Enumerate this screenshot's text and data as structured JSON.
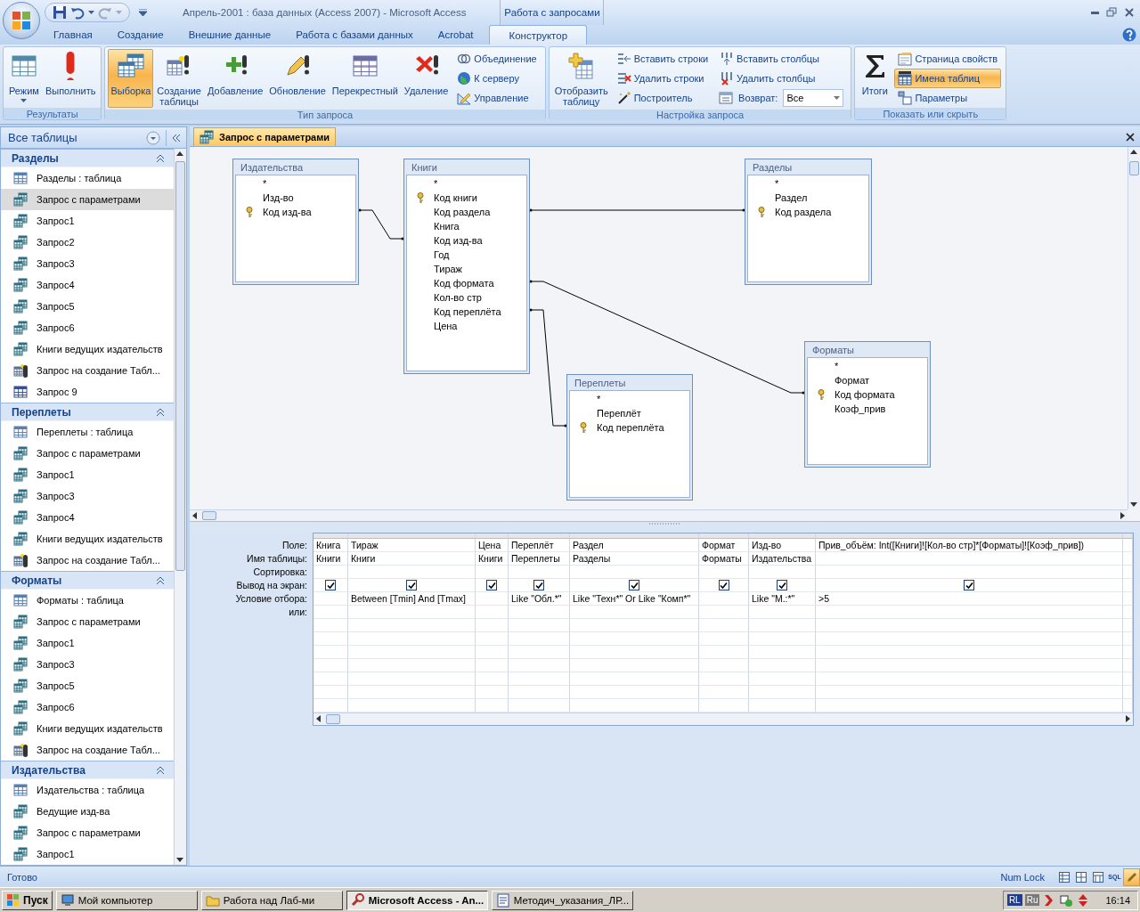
{
  "window": {
    "title": "Апрель-2001 : база данных (Access 2007)  -  Microsoft Access",
    "context_tab": "Работа с запросами"
  },
  "ribbon_tabs": [
    {
      "label": "Главная",
      "selected": false
    },
    {
      "label": "Создание",
      "selected": false
    },
    {
      "label": "Внешние данные",
      "selected": false
    },
    {
      "label": "Работа с базами данных",
      "selected": false
    },
    {
      "label": "Acrobat",
      "selected": false
    },
    {
      "label": "Конструктор",
      "selected": true
    }
  ],
  "ribbon_groups": [
    {
      "title": "Результаты",
      "large": [
        {
          "label": "Режим",
          "dropdown": true,
          "selected": false
        },
        {
          "label": "Выполнить",
          "dropdown": false,
          "selected": false
        }
      ]
    },
    {
      "title": "Тип запроса",
      "large": [
        {
          "label": "Выборка",
          "dropdown": false,
          "selected": true
        },
        {
          "label": "Создание\nтаблицы",
          "dropdown": false,
          "selected": false
        },
        {
          "label": "Добавление",
          "dropdown": false,
          "selected": false
        },
        {
          "label": "Обновление",
          "dropdown": false,
          "selected": false
        },
        {
          "label": "Перекрестный",
          "dropdown": false,
          "selected": false
        },
        {
          "label": "Удаление",
          "dropdown": false,
          "selected": false
        }
      ],
      "small_columns": [
        [
          {
            "label": "Объединение",
            "kind": "button",
            "selected": false
          },
          {
            "label": "К серверу",
            "kind": "button",
            "selected": false
          },
          {
            "label": "Управление",
            "kind": "button",
            "selected": false
          }
        ]
      ]
    },
    {
      "title": "Настройка запроса",
      "large": [
        {
          "label": "Отобразить\nтаблицу",
          "dropdown": false,
          "selected": false
        }
      ],
      "small_columns": [
        [
          {
            "label": "Вставить строки",
            "kind": "button",
            "selected": false
          },
          {
            "label": "Удалить строки",
            "kind": "button",
            "selected": false
          },
          {
            "label": "Построитель",
            "kind": "button",
            "selected": false
          }
        ],
        [
          {
            "label": "Вставить столбцы",
            "kind": "button",
            "selected": false
          },
          {
            "label": "Удалить столбцы",
            "kind": "button",
            "selected": false
          },
          {
            "label": "Возврат:",
            "kind": "combo",
            "value": "Все"
          }
        ]
      ]
    },
    {
      "title": "Показать или скрыть",
      "large": [
        {
          "label": "Итоги",
          "dropdown": false,
          "selected": false
        }
      ],
      "small_columns": [
        [
          {
            "label": "Страница свойств",
            "kind": "button",
            "selected": false
          },
          {
            "label": "Имена таблиц",
            "kind": "button",
            "selected": true
          },
          {
            "label": "Параметры",
            "kind": "button",
            "selected": false
          }
        ]
      ]
    }
  ],
  "navigation": {
    "title": "Все таблицы",
    "groups": [
      {
        "title": "Разделы",
        "expanded": true,
        "items": [
          {
            "label": "Разделы : таблица",
            "kind": "table",
            "selected": false
          },
          {
            "label": "Запрос с параметрами",
            "kind": "query",
            "selected": true
          },
          {
            "label": "Запрос1",
            "kind": "query",
            "selected": false
          },
          {
            "label": "Запрос2",
            "kind": "query",
            "selected": false
          },
          {
            "label": "Запрос3",
            "kind": "query",
            "selected": false
          },
          {
            "label": "Запрос4",
            "kind": "query",
            "selected": false
          },
          {
            "label": "Запрос5",
            "kind": "query",
            "selected": false
          },
          {
            "label": "Запрос6",
            "kind": "query",
            "selected": false
          },
          {
            "label": "Книги ведущих издательств",
            "kind": "query",
            "selected": false
          },
          {
            "label": "Запрос на создание Табл...",
            "kind": "make_table",
            "selected": false
          },
          {
            "label": "Запрос 9",
            "kind": "crosstab",
            "selected": false
          }
        ]
      },
      {
        "title": "Переплеты",
        "expanded": true,
        "items": [
          {
            "label": "Переплеты : таблица",
            "kind": "table",
            "selected": false
          },
          {
            "label": "Запрос с параметрами",
            "kind": "query",
            "selected": false
          },
          {
            "label": "Запрос1",
            "kind": "query",
            "selected": false
          },
          {
            "label": "Запрос3",
            "kind": "query",
            "selected": false
          },
          {
            "label": "Запрос4",
            "kind": "query",
            "selected": false
          },
          {
            "label": "Книги ведущих издательств",
            "kind": "query",
            "selected": false
          },
          {
            "label": "Запрос на создание Табл...",
            "kind": "make_table",
            "selected": false
          }
        ]
      },
      {
        "title": "Форматы",
        "expanded": true,
        "items": [
          {
            "label": "Форматы : таблица",
            "kind": "table",
            "selected": false
          },
          {
            "label": "Запрос с параметрами",
            "kind": "query",
            "selected": false
          },
          {
            "label": "Запрос1",
            "kind": "query",
            "selected": false
          },
          {
            "label": "Запрос3",
            "kind": "query",
            "selected": false
          },
          {
            "label": "Запрос5",
            "kind": "query",
            "selected": false
          },
          {
            "label": "Запрос6",
            "kind": "query",
            "selected": false
          },
          {
            "label": "Книги ведущих издательств",
            "kind": "query",
            "selected": false
          },
          {
            "label": "Запрос на создание Табл...",
            "kind": "make_table",
            "selected": false
          }
        ]
      },
      {
        "title": "Издательства",
        "expanded": true,
        "items": [
          {
            "label": "Издательства : таблица",
            "kind": "table",
            "selected": false
          },
          {
            "label": "Ведущие изд-ва",
            "kind": "query",
            "selected": false
          },
          {
            "label": "Запрос с параметрами",
            "kind": "query",
            "selected": false
          },
          {
            "label": "Запрос1",
            "kind": "query",
            "selected": false
          }
        ]
      }
    ]
  },
  "document_tab": {
    "title": "Запрос с параметрами"
  },
  "diagram": {
    "tables": [
      {
        "title": "Издательства",
        "fields": [
          {
            "name": "*",
            "key": false
          },
          {
            "name": "Изд-во",
            "key": false
          },
          {
            "name": "Код изд-ва",
            "key": true
          }
        ]
      },
      {
        "title": "Книги",
        "fields": [
          {
            "name": "*",
            "key": false
          },
          {
            "name": "Код книги",
            "key": true
          },
          {
            "name": "Код раздела",
            "key": false
          },
          {
            "name": "Книга",
            "key": false
          },
          {
            "name": "Код изд-ва",
            "key": false
          },
          {
            "name": "Год",
            "key": false
          },
          {
            "name": "Тираж",
            "key": false
          },
          {
            "name": "Код формата",
            "key": false
          },
          {
            "name": "Кол-во стр",
            "key": false
          },
          {
            "name": "Код переплёта",
            "key": false
          },
          {
            "name": "Цена",
            "key": false
          }
        ]
      },
      {
        "title": "Разделы",
        "fields": [
          {
            "name": "*",
            "key": false
          },
          {
            "name": "Раздел",
            "key": false
          },
          {
            "name": "Код раздела",
            "key": true
          }
        ]
      },
      {
        "title": "Форматы",
        "fields": [
          {
            "name": "*",
            "key": false
          },
          {
            "name": "Формат",
            "key": false
          },
          {
            "name": "Код формата",
            "key": true
          },
          {
            "name": "Коэф_прив",
            "key": false
          }
        ]
      },
      {
        "title": "Переплеты",
        "fields": [
          {
            "name": "*",
            "key": false
          },
          {
            "name": "Переплёт",
            "key": false
          },
          {
            "name": "Код переплёта",
            "key": true
          }
        ]
      }
    ]
  },
  "query_grid": {
    "row_labels": [
      "Поле:",
      "Имя таблицы:",
      "Сортировка:",
      "Вывод на экран:",
      "Условие отбора:",
      "или:"
    ],
    "columns": [
      {
        "field": "Книга",
        "table": "Книги",
        "show": true
      },
      {
        "field": "Тираж",
        "table": "Книги",
        "show": true,
        "criteria": "Between [Tmin] And [Tmax]"
      },
      {
        "field": "Цена",
        "table": "Книги",
        "show": true
      },
      {
        "field": "Переплёт",
        "table": "Переплеты",
        "show": true,
        "criteria": "Like \"Обл.*\""
      },
      {
        "field": "Раздел",
        "table": "Разделы",
        "show": true,
        "criteria": "Like \"Техн*\" Or Like \"Комп*\""
      },
      {
        "field": "Формат",
        "table": "Форматы",
        "show": true
      },
      {
        "field": "Изд-во",
        "table": "Издательства",
        "show": true,
        "criteria": "Like \"М.:*\""
      },
      {
        "field": "Прив_объём: Int([Книги]![Кол-во стр]*[Форматы]![Коэф_прив])",
        "show": true,
        "criteria": ">5"
      }
    ]
  },
  "status_bar": {
    "text": "Готово",
    "num_lock": "Num Lock",
    "view_buttons": [
      {
        "selected": false
      },
      {
        "selected": false
      },
      {
        "selected": false
      },
      {
        "label": "SQL",
        "selected": false
      },
      {
        "selected": true
      }
    ]
  },
  "taskbar": {
    "start": "Пуск",
    "tasks": [
      {
        "label": "Мой компьютер",
        "selected": false
      },
      {
        "label": "Работа над Лаб-ми",
        "selected": false
      },
      {
        "label": "Microsoft Access - An...",
        "selected": true
      },
      {
        "label": "Методич_указания_ЛР...",
        "selected": false
      }
    ],
    "language_indicators": [
      "RL",
      "Ru"
    ],
    "clock": "16:14"
  }
}
